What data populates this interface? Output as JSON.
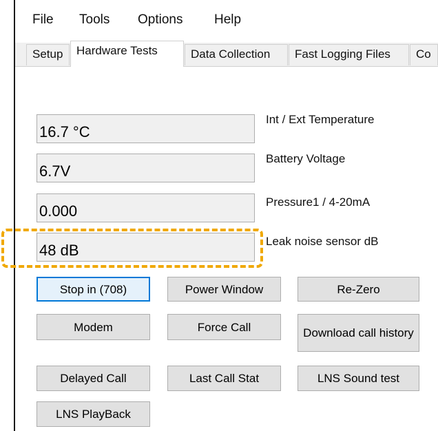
{
  "menu": {
    "file": "File",
    "tools": "Tools",
    "options": "Options",
    "help": "Help"
  },
  "tabs": [
    {
      "label": "Setup",
      "active": false
    },
    {
      "label": "Hardware Tests",
      "active": true
    },
    {
      "label": "Data Collection",
      "active": false
    },
    {
      "label": "Fast Logging Files",
      "active": false
    },
    {
      "label": "Co",
      "active": false
    }
  ],
  "readings": [
    {
      "value": "16.7 °C",
      "label": "Int / Ext Temperature"
    },
    {
      "value": "6.7V",
      "label": "Battery Voltage"
    },
    {
      "value": "0.000",
      "label": "Pressure1 / 4-20mA"
    },
    {
      "value": "48 dB",
      "label": "Leak noise sensor dB"
    }
  ],
  "buttons": {
    "stop_in": "Stop in (708)",
    "power_window": "Power Window",
    "re_zero": "Re-Zero",
    "modem": "Modem",
    "force_call": "Force Call",
    "download_call_history": "Download call history",
    "delayed_call": "Delayed Call",
    "last_call_stat": "Last Call Stat",
    "lns_sound_test": "LNS Sound test",
    "lns_playback": "LNS PlayBack"
  },
  "colors": {
    "highlight": "#f0a800",
    "focus_border": "#0078d7"
  }
}
